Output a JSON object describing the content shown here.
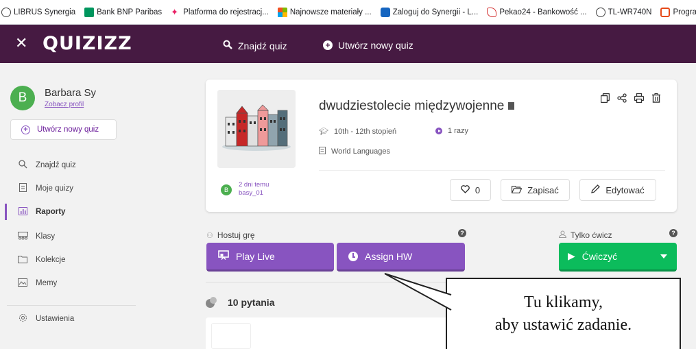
{
  "bookmarks": [
    {
      "label": "LIBRUS Synergia",
      "icon": "globe-icon"
    },
    {
      "label": "Bank BNP Paribas",
      "icon": "bnp-icon"
    },
    {
      "label": "Platforma do rejestracj...",
      "icon": "star-icon"
    },
    {
      "label": "Najnowsze materiały ...",
      "icon": "grid-icon"
    },
    {
      "label": "Zaloguj do Synergii - L...",
      "icon": "l-icon"
    },
    {
      "label": "Pekao24 - Bankowość ...",
      "icon": "pekao-icon"
    },
    {
      "label": "TL-WR740N",
      "icon": "globe-icon"
    },
    {
      "label": "Program",
      "icon": "program-icon"
    }
  ],
  "topnav": {
    "close": "✕",
    "logo": "QUIZIZZ",
    "search_label": "Znajdź quiz",
    "create_label": "Utwórz nowy quiz"
  },
  "sidebar": {
    "avatar_letter": "B",
    "user_name": "Barbara Sy",
    "profile_link": "Zobacz profil",
    "create_button": "Utwórz nowy quiz",
    "items": [
      {
        "label": "Znajdź quiz",
        "icon": "search-icon",
        "glyph": "⚲"
      },
      {
        "label": "Moje quizy",
        "icon": "document-icon",
        "glyph": "▤"
      },
      {
        "label": "Raporty",
        "icon": "chart-icon",
        "glyph": "▥",
        "active": true
      },
      {
        "label": "Klasy",
        "icon": "people-icon",
        "glyph": "☷"
      },
      {
        "label": "Kolekcje",
        "icon": "folder-icon",
        "glyph": "▭"
      },
      {
        "label": "Memy",
        "icon": "image-icon",
        "glyph": "▨"
      },
      {
        "label": "Ustawienia",
        "icon": "gear-icon",
        "glyph": "⚙"
      }
    ]
  },
  "quiz": {
    "title": "dwudziestolecie międzywojenne",
    "grade": "10th - 12th stopień",
    "plays": "1 razy",
    "subject": "World Languages",
    "author_letter": "B",
    "time_ago": "2 dni temu",
    "author": "basy_01",
    "likes": "0",
    "save_label": "Zapisać",
    "edit_label": "Edytować"
  },
  "host": {
    "host_label": "Hostuj grę",
    "practice_label": "Tylko ćwicz",
    "play_live": "Play Live",
    "assign_hw": "Assign HW",
    "practice_button": "Ćwiczyć",
    "help": "?"
  },
  "questions": {
    "title": "10 pytania"
  },
  "callout": {
    "line1": "Tu klikamy,",
    "line2": "aby ustawić zadanie."
  },
  "colors": {
    "nav": "#461a42",
    "purple": "#8854c0",
    "green": "#0cbc5c"
  }
}
